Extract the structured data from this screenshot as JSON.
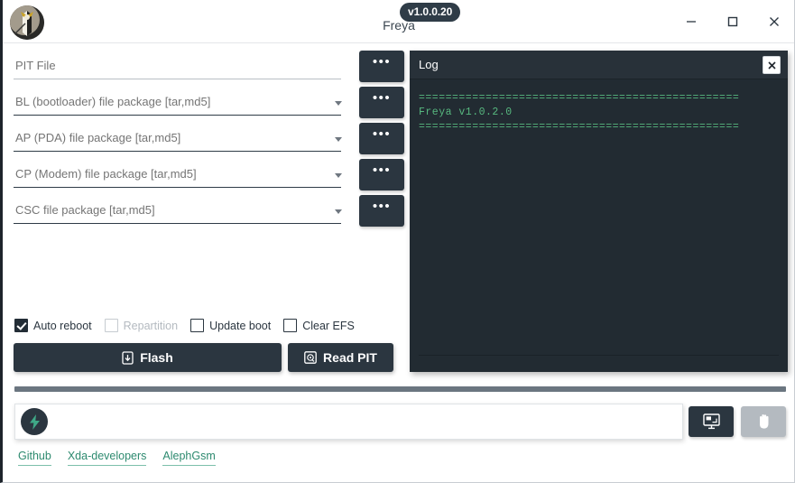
{
  "window": {
    "title": "Freya",
    "version_badge": "v1.0.0.20",
    "logo_icon": "freya-valkyrie-logo",
    "controls": {
      "minimize": "–",
      "maximize": "□",
      "close": "✕"
    }
  },
  "form": {
    "browse_label": "•••",
    "fields": [
      {
        "name": "pit-file",
        "label": "PIT File",
        "value": "",
        "is_placeholder": true,
        "has_dropdown": false
      },
      {
        "name": "bl-package",
        "label": "BL (bootloader) file package [tar,md5]",
        "value": "",
        "is_placeholder": false,
        "has_dropdown": true
      },
      {
        "name": "ap-package",
        "label": "AP (PDA) file package [tar,md5]",
        "value": "",
        "is_placeholder": false,
        "has_dropdown": true
      },
      {
        "name": "cp-package",
        "label": "CP (Modem) file package [tar,md5]",
        "value": "",
        "is_placeholder": false,
        "has_dropdown": true
      },
      {
        "name": "csc-package",
        "label": "CSC file package [tar,md5]",
        "value": "",
        "is_placeholder": false,
        "has_dropdown": true
      }
    ],
    "options": [
      {
        "label": "Auto reboot",
        "checked": true,
        "disabled": false
      },
      {
        "label": "Repartition",
        "checked": false,
        "disabled": true
      },
      {
        "label": "Update boot",
        "checked": false,
        "disabled": false
      },
      {
        "label": "Clear EFS",
        "checked": false,
        "disabled": false
      }
    ],
    "flash_label": "Flash",
    "flash_icon": "phone-download-icon",
    "read_pit_label": "Read PIT",
    "read_pit_icon": "hard-disk-icon"
  },
  "log": {
    "title": "Log",
    "close_label": "✕",
    "close_icon": "close-icon",
    "lines": [
      "",
      "",
      "================================================",
      "Freya v1.0.2.0",
      "================================================"
    ],
    "text_color": "#57b87f"
  },
  "progress": {
    "percent": 0
  },
  "status": {
    "icon": "lightning-bolt-icon",
    "text": "",
    "placeholder": "",
    "display_button_icon": "monitor-screen-icon",
    "stop_button_icon": "hand-stop-icon"
  },
  "links": [
    {
      "label": "Github"
    },
    {
      "label": "Xda-developers"
    },
    {
      "label": "AlephGsm"
    }
  ],
  "colors": {
    "accent_dark": "#2b3640",
    "panel_dark": "#222b32",
    "panel_header": "#283139",
    "log_green": "#57b87f",
    "link_teal": "#2d8a6f",
    "disabled_gray": "#b4bac0"
  }
}
